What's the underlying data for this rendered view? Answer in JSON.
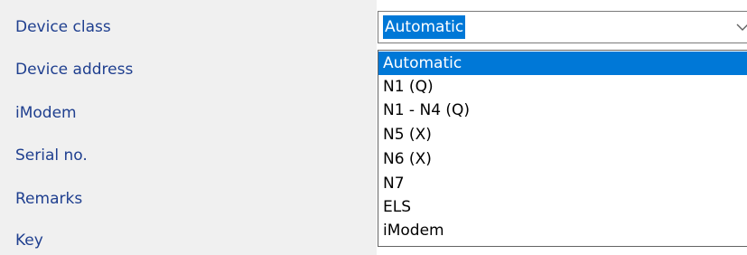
{
  "form": {
    "labels": [
      "Device class",
      "Device address",
      "iModem",
      "Serial no.",
      "Remarks",
      "Key"
    ]
  },
  "device_class_select": {
    "selected_value": "Automatic",
    "arrow_icon": "chevron-down-icon",
    "options": [
      "Automatic",
      "N1 (Q)",
      "N1 - N4 (Q)",
      "N5 (X)",
      "N6 (X)",
      "N7",
      "ELS",
      "iModem"
    ],
    "highlighted_option": "Automatic"
  },
  "colors": {
    "label_text": "#1f3f8f",
    "selection_bg": "#0078d7",
    "panel_bg": "#f0f0f0"
  }
}
